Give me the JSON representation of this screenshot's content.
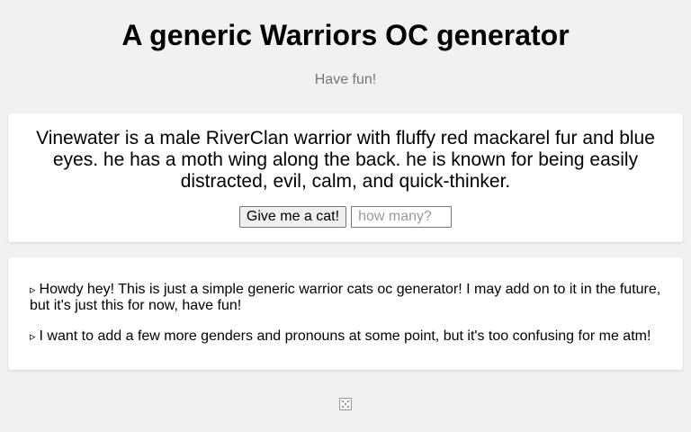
{
  "header": {
    "title": "A generic Warriors OC generator",
    "subtitle": "Have fun!"
  },
  "result": {
    "text": "Vinewater is a male RiverClan warrior with fluffy red mackarel fur and blue eyes. he has a moth wing along the back. he is known for being easily distracted, evil, calm, and quick-thinker."
  },
  "controls": {
    "give_label": "Give me a cat!",
    "count_placeholder": "how many?"
  },
  "notes": {
    "bullet": "▹",
    "items": [
      "Howdy hey! This is just a simple generic warrior cats oc generator! I may add on to it in the future, but it's just this for now, have fun!",
      "I want to add a few more genders and pronouns at some point, but it's too confusing for me atm!"
    ]
  },
  "footer": {
    "icon": "dice-icon"
  },
  "colors": {
    "background": "#f1f1f1",
    "card": "#ffffff",
    "subtitle": "#777777"
  }
}
